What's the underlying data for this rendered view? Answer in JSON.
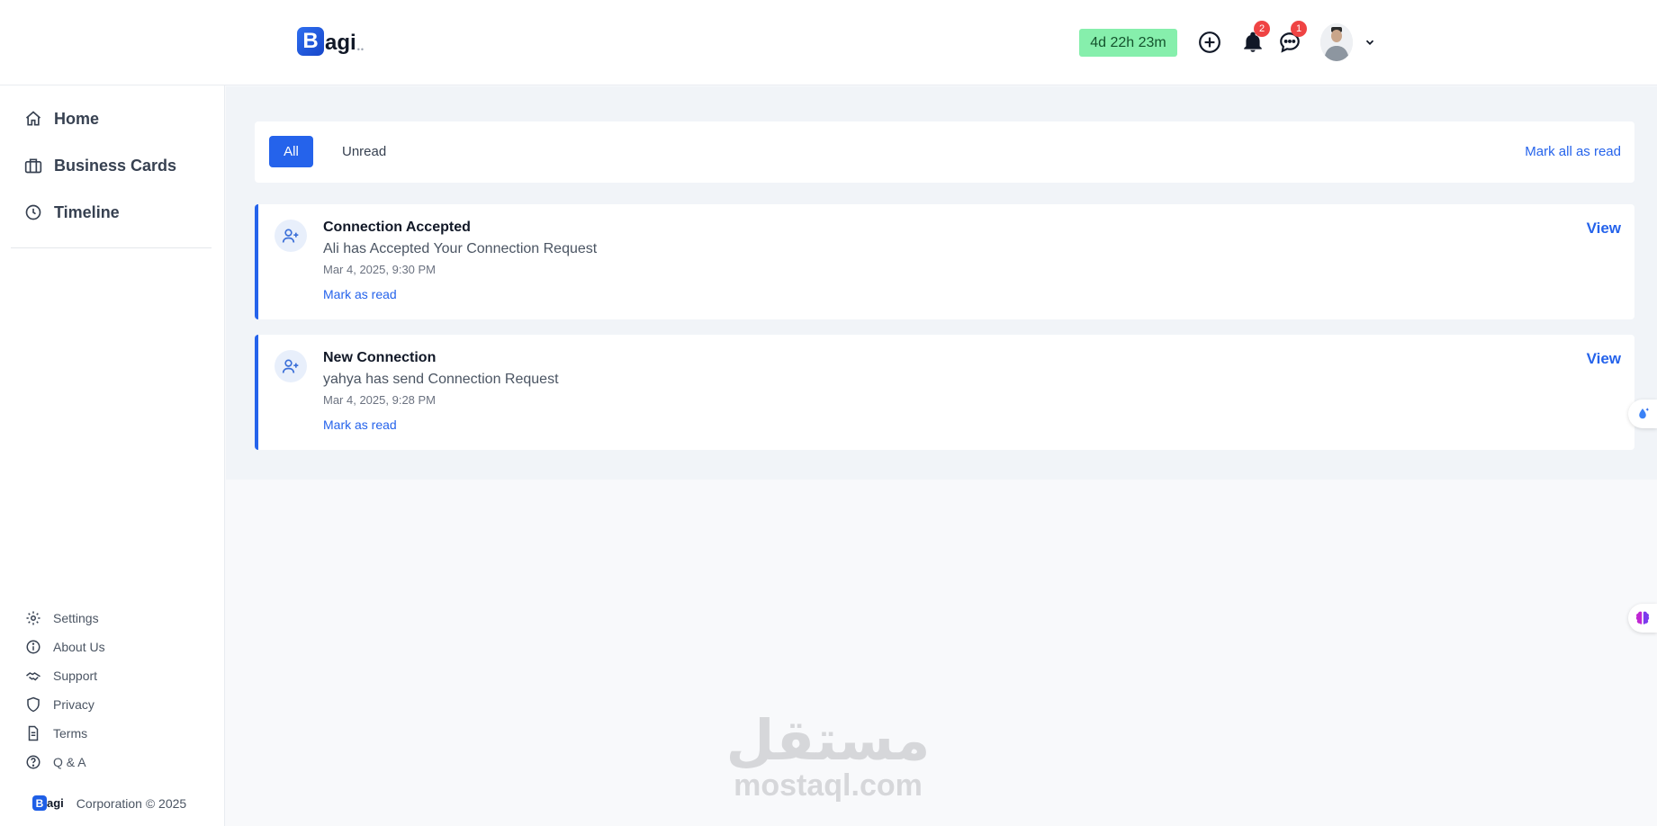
{
  "header": {
    "logo_letter": "B",
    "logo_rest": "agi",
    "timer": "4d 22h 23m",
    "notification_count": "2",
    "message_count": "1"
  },
  "sidebar": {
    "nav": [
      {
        "label": "Home",
        "icon": "home-icon"
      },
      {
        "label": "Business Cards",
        "icon": "briefcase-icon"
      },
      {
        "label": "Timeline",
        "icon": "clock-icon"
      }
    ],
    "footer": [
      {
        "label": "Settings",
        "icon": "gear-icon"
      },
      {
        "label": "About Us",
        "icon": "info-icon"
      },
      {
        "label": "Support",
        "icon": "handshake-icon"
      },
      {
        "label": "Privacy",
        "icon": "shield-icon"
      },
      {
        "label": "Terms",
        "icon": "document-icon"
      },
      {
        "label": "Q & A",
        "icon": "question-icon"
      }
    ],
    "corporation": "Corporation © 2025",
    "mini_logo_letter": "B",
    "mini_logo_rest": "agi"
  },
  "filters": {
    "all": "All",
    "unread": "Unread",
    "mark_all": "Mark all as read"
  },
  "notifications": [
    {
      "title": "Connection Accepted",
      "body": "Ali has Accepted Your Connection Request",
      "time": "Mar 4, 2025, 9:30 PM",
      "mark": "Mark as read",
      "view": "View"
    },
    {
      "title": "New Connection",
      "body": "yahya has send Connection Request",
      "time": "Mar 4, 2025, 9:28 PM",
      "mark": "Mark as read",
      "view": "View"
    }
  ],
  "watermark": {
    "arabic": "مستقل",
    "latin": "mostaql.com"
  },
  "colors": {
    "accent": "#2563eb",
    "timer_bg": "#86efac",
    "badge": "#ef4444"
  }
}
